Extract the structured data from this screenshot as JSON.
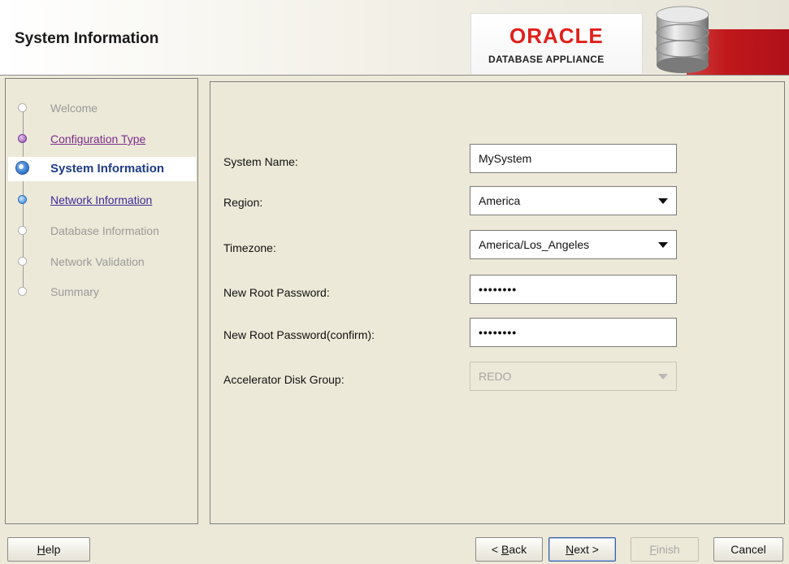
{
  "header": {
    "title": "System Information",
    "logo": {
      "brand": "ORACLE",
      "product": "DATABASE APPLIANCE",
      "brand_color": "#e0201b"
    }
  },
  "nav": {
    "items": [
      {
        "label": "Welcome",
        "state": "disabled"
      },
      {
        "label": "Configuration Type",
        "state": "visited"
      },
      {
        "label": "System Information",
        "state": "current"
      },
      {
        "label": "Network Information",
        "state": "link"
      },
      {
        "label": "Database Information",
        "state": "disabled"
      },
      {
        "label": "Network Validation",
        "state": "disabled"
      },
      {
        "label": "Summary",
        "state": "disabled"
      }
    ]
  },
  "form": {
    "system_name": {
      "label": "System Name:",
      "value": "MySystem"
    },
    "region": {
      "label": "Region:",
      "value": "America"
    },
    "timezone": {
      "label": "Timezone:",
      "value": "America/Los_Angeles"
    },
    "root_password": {
      "label": "New Root Password:",
      "value": "••••••••"
    },
    "root_password_confirm": {
      "label": "New Root Password(confirm):",
      "value": "••••••••"
    },
    "accelerator_disk_group": {
      "label": "Accelerator Disk Group:",
      "value": "REDO"
    }
  },
  "buttons": {
    "help": {
      "mnemonic": "H",
      "rest": "elp"
    },
    "back": {
      "prefix": "< ",
      "mnemonic": "B",
      "rest": "ack"
    },
    "next": {
      "mnemonic": "N",
      "rest": "ext >"
    },
    "finish": {
      "mnemonic": "F",
      "rest": "inish"
    },
    "cancel": {
      "label": "Cancel"
    }
  }
}
